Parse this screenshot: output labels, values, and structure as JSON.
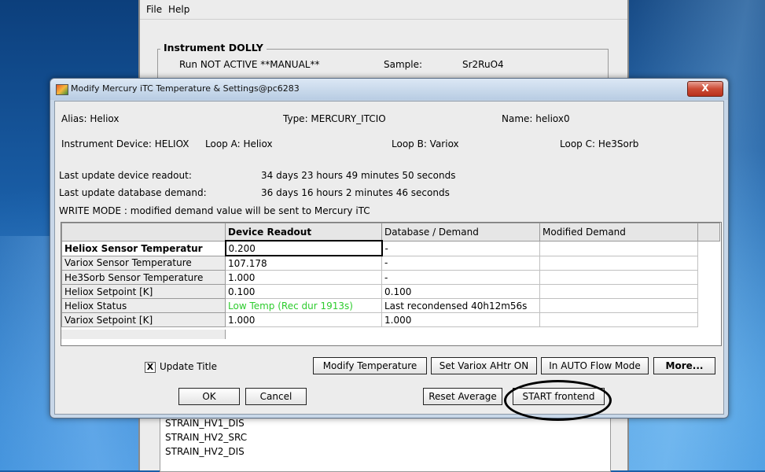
{
  "bg_window": {
    "menu": [
      "File",
      "Help"
    ],
    "instrument_title": "Instrument DOLLY",
    "run_status": "Run NOT ACTIVE **MANUAL**",
    "sample_label": "Sample:",
    "sample_value": "Sr2RuO4",
    "list_items": [
      "STRAIN_HV1_DIS",
      "STRAIN_HV2_SRC",
      "STRAIN_HV2_DIS"
    ]
  },
  "dialog": {
    "title": "Modify Mercury iTC Temperature & Settings@pc6283",
    "close_label": "X",
    "alias": "Alias: Heliox",
    "type": "Type: MERCURY_ITCIO",
    "name": "Name: heliox0",
    "instrument_device": "Instrument Device: HELIOX",
    "loop_a": "Loop A: Heliox",
    "loop_b": "Loop B: Variox",
    "loop_c": "Loop C: He3Sorb",
    "last_update_readout_label": "Last update device readout:",
    "last_update_readout_value": "34 days 23 hours 49 minutes 50 seconds",
    "last_update_demand_label": "Last update database demand:",
    "last_update_demand_value": "36 days 16 hours 2 minutes 46 seconds",
    "write_mode": "WRITE MODE : modified demand value will be sent to Mercury iTC",
    "table": {
      "headers": [
        "",
        "Device Readout",
        "Database / Demand",
        "Modified Demand"
      ],
      "rows": [
        [
          "Heliox Sensor Temperatur",
          "0.200",
          "-",
          ""
        ],
        [
          "Variox Sensor Temperature",
          "107.178",
          "-",
          ""
        ],
        [
          "He3Sorb Sensor Temperature",
          "1.000",
          "-",
          ""
        ],
        [
          "Heliox Setpoint [K]",
          "0.100",
          "0.100",
          ""
        ],
        [
          "Heliox Status",
          "Low Temp (Rec dur 1913s)",
          "Last recondensed 40h12m56s",
          ""
        ],
        [
          "Variox Setpoint [K]",
          "1.000",
          "1.000",
          ""
        ]
      ]
    },
    "update_title_label": "Update Title",
    "update_title_checked": "X",
    "buttons": {
      "modify_temperature": "Modify Temperature",
      "set_variox": "Set Variox AHtr ON",
      "auto_flow": "In AUTO Flow Mode",
      "more": "More...",
      "ok": "OK",
      "cancel": "Cancel",
      "reset_average": "Reset Average",
      "start_frontend": "START frontend"
    },
    "colors": {
      "status_green": "#2ecc2e"
    }
  }
}
